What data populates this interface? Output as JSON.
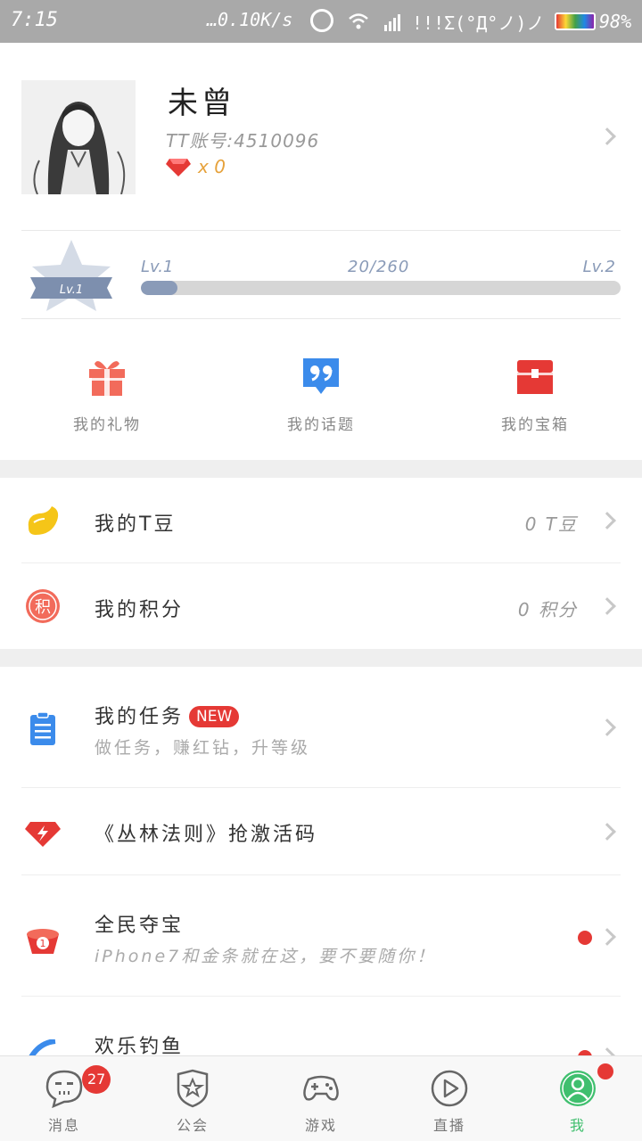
{
  "statusbar": {
    "time": "7:15",
    "net": "…0.10K/s",
    "face": "!!!Σ(°Д°ノ)ノ",
    "battery": "98%"
  },
  "profile": {
    "name": "未曾",
    "account": "TT账号:4510096",
    "gems": "x 0"
  },
  "level": {
    "badge": "Lv.1",
    "current": "Lv.1",
    "progress_text": "20/260",
    "next": "Lv.2",
    "progress": 0.077
  },
  "quick": [
    {
      "label": "我的礼物",
      "icon": "gift-icon"
    },
    {
      "label": "我的话题",
      "icon": "quote-icon"
    },
    {
      "label": "我的宝箱",
      "icon": "treasure-box-icon"
    }
  ],
  "rows": {
    "tbeans": {
      "title": "我的T豆",
      "value": "0 T豆"
    },
    "points": {
      "title": "我的积分",
      "value": "0 积分",
      "icon_text": "积"
    },
    "tasks": {
      "title": "我的任务",
      "badge": "NEW",
      "sub": "做任务，赚红钻，升等级"
    },
    "code": {
      "title": "《丛林法则》抢激活码"
    },
    "treasure": {
      "title": "全民夺宝",
      "sub": "iPhone7和金条就在这，要不要随你！"
    },
    "fishing": {
      "title": "欢乐钓鱼"
    }
  },
  "nav": {
    "messages": {
      "label": "消息",
      "badge": "27"
    },
    "guild": {
      "label": "公会"
    },
    "games": {
      "label": "游戏"
    },
    "live": {
      "label": "直播"
    },
    "me": {
      "label": "我"
    }
  },
  "colors": {
    "accent_green": "#3fbf6e",
    "red": "#e53935",
    "level_blue": "#8a9bb8"
  }
}
